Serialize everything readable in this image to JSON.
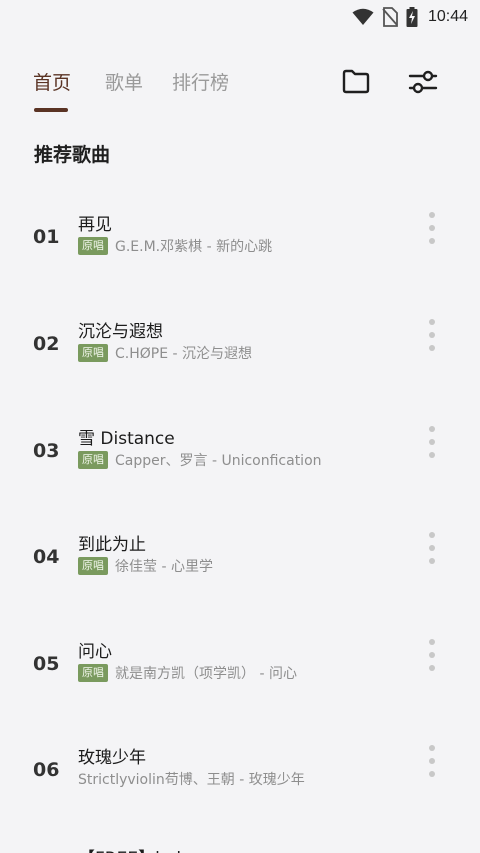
{
  "status_bar": {
    "time": "10:44"
  },
  "tabs": [
    {
      "label": "首页",
      "active": true
    },
    {
      "label": "歌单",
      "active": false
    },
    {
      "label": "排行榜",
      "active": false
    }
  ],
  "icons": {
    "folder": "folder-icon",
    "settings": "sliders-icon"
  },
  "section": {
    "title": "推荐歌曲"
  },
  "badge_label": "原唱",
  "songs": [
    {
      "num": "01",
      "title": "再见",
      "badge": "原唱",
      "artist": "G.E.M.邓紫棋 - 新的心跳"
    },
    {
      "num": "02",
      "title": "沉沦与遐想",
      "badge": "原唱",
      "artist": "C.HØPE - 沉沦与遐想"
    },
    {
      "num": "03",
      "title": "雪 Distance",
      "badge": "原唱",
      "artist": "Capper、罗言 - Uniconfication"
    },
    {
      "num": "04",
      "title": "到此为止",
      "badge": "原唱",
      "artist": "徐佳莹 - 心里学"
    },
    {
      "num": "05",
      "title": "问心",
      "badge": "原唱",
      "artist": "就是南方凯（项学凯） - 问心"
    },
    {
      "num": "06",
      "title": "玫瑰少年",
      "badge": "",
      "artist": "Strictlyviolin苟博、王朝 - 玫瑰少年"
    },
    {
      "num": "",
      "title": "【FREE】lodc...",
      "badge": "",
      "artist": ""
    }
  ],
  "colors": {
    "accent": "#5a3324",
    "badge": "#7a9a5e",
    "background": "#f4f4f6"
  }
}
